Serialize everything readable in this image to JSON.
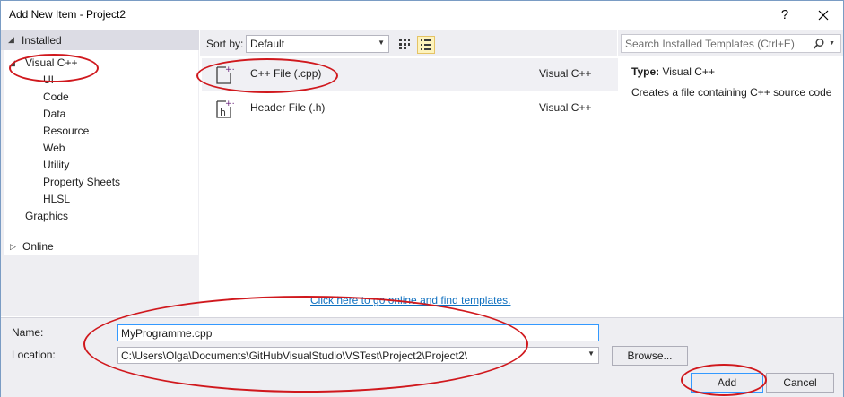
{
  "window": {
    "title": "Add New Item - Project2"
  },
  "titlebar": {
    "help_label": "?",
    "close_label": "✕"
  },
  "tree": {
    "installed_label": "Installed",
    "visual_cpp_label": "Visual C++",
    "children": [
      "UI",
      "Code",
      "Data",
      "Resource",
      "Web",
      "Utility",
      "Property Sheets",
      "HLSL"
    ],
    "graphics_label": "Graphics",
    "online_label": "Online"
  },
  "sortbar": {
    "label": "Sort by:",
    "value": "Default"
  },
  "search": {
    "placeholder": "Search Installed Templates (Ctrl+E)"
  },
  "templates": [
    {
      "name": "C++ File (.cpp)",
      "type": "Visual C++",
      "selected": true
    },
    {
      "name": "Header File (.h)",
      "type": "Visual C++",
      "selected": false
    }
  ],
  "online_link": "Click here to go online and find templates.",
  "details": {
    "type_label": "Type:",
    "type_value": "Visual C++",
    "description": "Creates a file containing C++ source code"
  },
  "form": {
    "name_label": "Name:",
    "name_value": "MyProgramme.cpp",
    "location_label": "Location:",
    "location_value": "C:\\Users\\Olga\\Documents\\GitHubVisualStudio\\VSTest\\Project2\\Project2\\"
  },
  "buttons": {
    "browse": "Browse...",
    "add": "Add",
    "cancel": "Cancel"
  },
  "colors": {
    "annotation": "#d0181d",
    "link": "#0e70c0",
    "icon_accent": "#68217a"
  }
}
